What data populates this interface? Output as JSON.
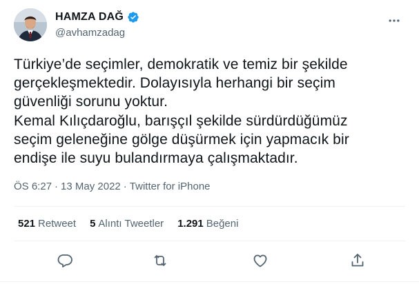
{
  "author": {
    "display_name": "HAMZA DAĞ",
    "handle": "@avhamzadag",
    "verified": true,
    "avatar_icon": "profile-photo"
  },
  "tweet": {
    "text": "Türkiye’de seçimler, demokratik ve temiz bir şekilde\ngerçekleşmektedir. Dolayısıyla herhangi bir seçim\ngüvenliği sorunu yoktur.\nKemal Kılıçdaroğlu, barışçıl şekilde sürdürdüğümüz\nseçim geleneğine gölge düşürmek için yapmacık bir\nendişe ile suyu bulandırmaya çalışmaktadır.",
    "time": "ÖS 6:27",
    "separator": "·",
    "date": "13 May 2022",
    "source": "Twitter for iPhone"
  },
  "stats": {
    "retweets": {
      "count": "521",
      "label": "Retweet"
    },
    "quotes": {
      "count": "5",
      "label": "Alıntı Tweetler"
    },
    "likes": {
      "count": "1.291",
      "label": "Beğeni"
    }
  },
  "actions": [
    "reply-icon",
    "retweet-icon",
    "like-icon",
    "share-icon"
  ],
  "colors": {
    "text": "#0f1419",
    "muted": "#536471",
    "verified": "#1d9bf0",
    "divider": "#eff3f4"
  }
}
